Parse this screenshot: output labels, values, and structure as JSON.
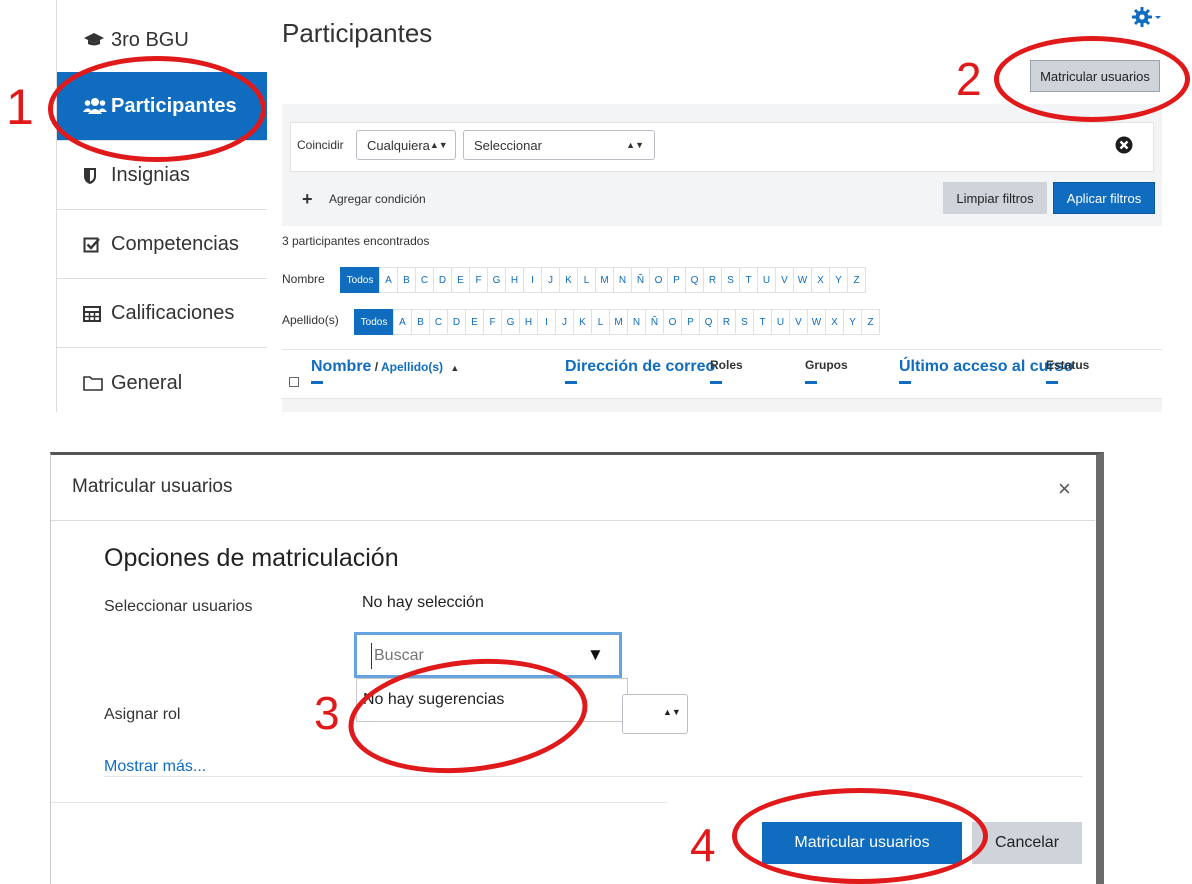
{
  "sidebar": {
    "items": [
      {
        "label": "3ro BGU",
        "icon": "graduation-cap-icon"
      },
      {
        "label": "Participantes",
        "icon": "users-icon",
        "active": true
      },
      {
        "label": "Insignias",
        "icon": "shield-icon"
      },
      {
        "label": "Competencias",
        "icon": "checkbox-icon"
      },
      {
        "label": "Calificaciones",
        "icon": "table-icon"
      },
      {
        "label": "General",
        "icon": "folder-icon"
      }
    ]
  },
  "main": {
    "title": "Participantes",
    "enrol_button": "Matricular usuarios",
    "filter": {
      "match_label": "Coincidir",
      "match_value": "Cualquiera",
      "select_value": "Seleccionar",
      "add_condition": "Agregar condición",
      "clear_button": "Limpiar filtros",
      "apply_button": "Aplicar filtros"
    },
    "found_text": "3 participantes encontrados",
    "initials": {
      "first_label": "Nombre",
      "last_label": "Apellido(s)",
      "all_label": "Todos",
      "letters": [
        "A",
        "B",
        "C",
        "D",
        "E",
        "F",
        "G",
        "H",
        "I",
        "J",
        "K",
        "L",
        "M",
        "N",
        "Ñ",
        "O",
        "P",
        "Q",
        "R",
        "S",
        "T",
        "U",
        "V",
        "W",
        "X",
        "Y",
        "Z"
      ]
    },
    "table_headers": {
      "name": "Nombre",
      "separator": " / ",
      "surname": "Apellido(s)",
      "email": "Dirección de correo",
      "roles": "Roles",
      "groups": "Grupos",
      "last_access": "Último acceso al curso",
      "status": "Estatus"
    }
  },
  "modal": {
    "title": "Matricular usuarios",
    "close": "×",
    "section_title": "Opciones de matriculación",
    "select_users_label": "Seleccionar usuarios",
    "no_selection": "No hay selección",
    "search_placeholder": "Buscar",
    "no_suggestions": "No hay sugerencias",
    "assign_role_label": "Asignar rol",
    "show_more": "Mostrar más...",
    "submit_button": "Matricular usuarios",
    "cancel_button": "Cancelar"
  },
  "annotations": {
    "step1": "1",
    "step2": "2",
    "step3": "3",
    "step4": "4"
  },
  "colors": {
    "accent": "#0f6cbf",
    "annotation": "#e0191a",
    "button_gray": "#ced4da"
  }
}
